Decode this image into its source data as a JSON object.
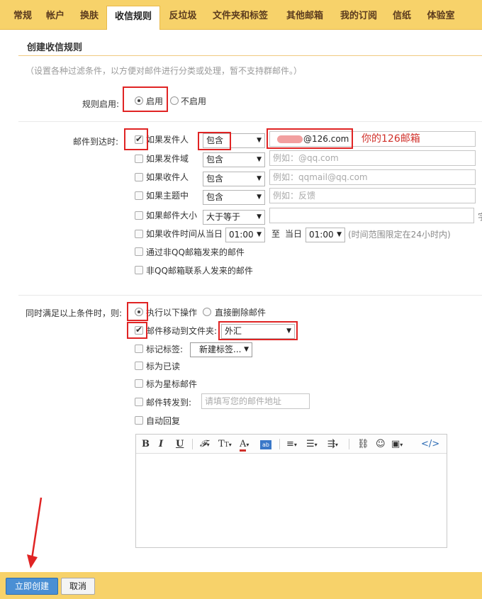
{
  "tabs": [
    {
      "label": "常规"
    },
    {
      "label": "帐户"
    },
    {
      "label": "换肤"
    },
    {
      "label": "收信规则"
    },
    {
      "label": "反垃圾"
    },
    {
      "label": "文件夹和标签"
    },
    {
      "label": "其他邮箱"
    },
    {
      "label": "我的订阅"
    },
    {
      "label": "信纸"
    },
    {
      "label": "体验室"
    }
  ],
  "page": {
    "title": "创建收信规则",
    "description": "（设置各种过滤条件，以方便对邮件进行分类或处理，暂不支持群邮件。）"
  },
  "rule_enable": {
    "label": "规则启用:",
    "on": "启用",
    "off": "不启用"
  },
  "conditions": {
    "label": "邮件到达时:",
    "sender": {
      "label": "如果发件人",
      "op": "包含",
      "value": "@126.com"
    },
    "sender_domain": {
      "label": "如果发件域",
      "op": "包含",
      "placeholder": "例如：@qq.com"
    },
    "recipient": {
      "label": "如果收件人",
      "op": "包含",
      "placeholder": "例如：qqmail@qq.com"
    },
    "subject": {
      "label": "如果主题中",
      "op": "包含",
      "placeholder": "例如：反馈"
    },
    "size": {
      "label": "如果邮件大小",
      "op": "大于等于",
      "unit_partial": "字"
    },
    "time": {
      "label": "如果收件时间从当日",
      "from": "01:00",
      "to_label": "至",
      "day_label": "当日",
      "to": "01:00",
      "hint": "(时间范围限定在24小时内)"
    },
    "non_qq": {
      "label": "通过非QQ邮箱发来的邮件"
    },
    "non_contact": {
      "label": "非QQ邮箱联系人发来的邮件"
    }
  },
  "annotation": "你的126邮箱",
  "actions": {
    "label": "同时满足以上条件时，则:",
    "execute": "执行以下操作",
    "delete": "直接删除邮件",
    "move": {
      "label": "邮件移动到文件夹:",
      "value": "外汇"
    },
    "tag": {
      "label": "标记标签:",
      "value": "新建标签..."
    },
    "mark_read": "标为已读",
    "mark_star": "标为星标邮件",
    "forward": {
      "label": "邮件转发到:",
      "placeholder": "请填写您的邮件地址"
    },
    "auto_reply": "自动回复"
  },
  "editor_toolbar": {
    "bold": "B",
    "italic": "I",
    "underline": "U",
    "code": "</>"
  },
  "buttons": {
    "create": "立即创建",
    "cancel": "取消"
  },
  "colors": {
    "topbar": "#f7d26a",
    "highlight": "#e02424",
    "primary_button": "#4a8fd4",
    "annotation": "#d0302a"
  }
}
